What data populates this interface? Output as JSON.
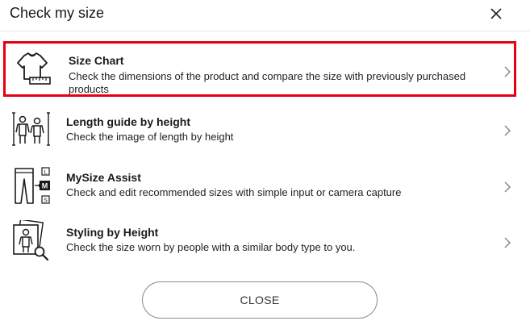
{
  "dialog": {
    "title": "Check my size",
    "close_icon": "close-icon"
  },
  "options": [
    {
      "title": "Size Chart",
      "description": "Check the dimensions of the product and compare the size with previously purchased products",
      "icon": "tshirt-ruler-icon",
      "highlighted": true,
      "highlight_color": "#e60012"
    },
    {
      "title": "Length guide by height",
      "description": "Check the image of length by height",
      "icon": "height-figures-icon"
    },
    {
      "title": "MySize Assist",
      "description": "Check and edit recommended sizes with simple input or camera capture",
      "icon": "pants-size-icon",
      "size_labels": [
        "L",
        "M",
        "S"
      ]
    },
    {
      "title": "Styling by Height",
      "description": "Check the size worn by people with a similar body type to you.",
      "icon": "photo-search-icon"
    }
  ],
  "footer": {
    "close_label": "CLOSE"
  }
}
